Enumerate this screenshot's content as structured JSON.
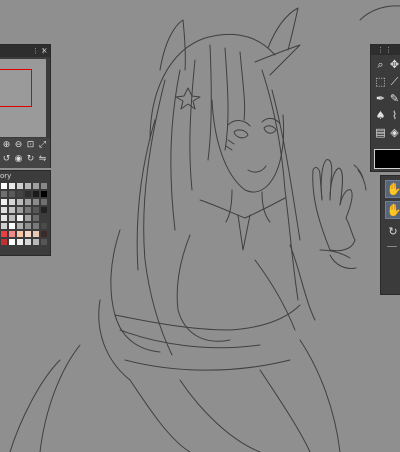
{
  "canvas": {
    "background_color": "#8f8f8f",
    "line_color": "#3f3f3f",
    "content": "pencil-sketch-illustration"
  },
  "navigator": {
    "panel_icon": "panel-grip-icon",
    "close_label": "×",
    "viewbox_color": "#e00000",
    "buttons": [
      "zoom-in-icon",
      "zoom-out-icon",
      "fit-icon",
      "rotate-left-icon",
      "rotate-right-icon",
      "flip-icon",
      "reset-icon",
      "fullscreen-icon"
    ]
  },
  "color_set": {
    "title": "ory",
    "swatches": [
      "#ffffff",
      "#e9e9e9",
      "#cfcfcf",
      "#b7b7b7",
      "#9f9f9f",
      "#888888",
      "#707070",
      "#5a5a5a",
      "#444444",
      "#2e2e2e",
      "#1a1a1a",
      "#000000",
      "#f2f2f2",
      "#d6d6d6",
      "#bcbcbc",
      "#a3a3a3",
      "#8b8b8b",
      "#6f6f6f",
      "#dfdfdf",
      "#c4c4c4",
      "#9e9e9e",
      "#787878",
      "#585858",
      "#222222",
      "#e6e6e6",
      "#bdbdbd",
      "#f0f0f0",
      "#a1a1a1",
      "#6a6a6a",
      "#3c3c3c",
      "#cfcfcf",
      "#ffffff",
      "#b0b0b0",
      "#919191",
      "#7a7a7a",
      "#4a4a4a",
      "#e84040",
      "#f08a8a",
      "#f6c6a6",
      "#f3d9c6",
      "#e8c9b4",
      "#3a2a2a",
      "#c03030",
      "#ffffff",
      "#eeeeee",
      "#d8d8d8",
      "#b8b8b8",
      "#555555"
    ]
  },
  "tool_panel": {
    "tools": [
      "zoom-icon",
      "move-icon",
      "select-icon",
      "eyedropper-icon",
      "pen-icon",
      "pencil-icon",
      "brush-icon",
      "airbrush-icon",
      "eraser-icon",
      "fill-icon",
      "figure-icon",
      "text-icon"
    ],
    "current_color": "#000000"
  },
  "sub_tool_panel": {
    "items": [
      "hand-icon",
      "hand-icon"
    ],
    "refresh_glyph": "↻"
  }
}
